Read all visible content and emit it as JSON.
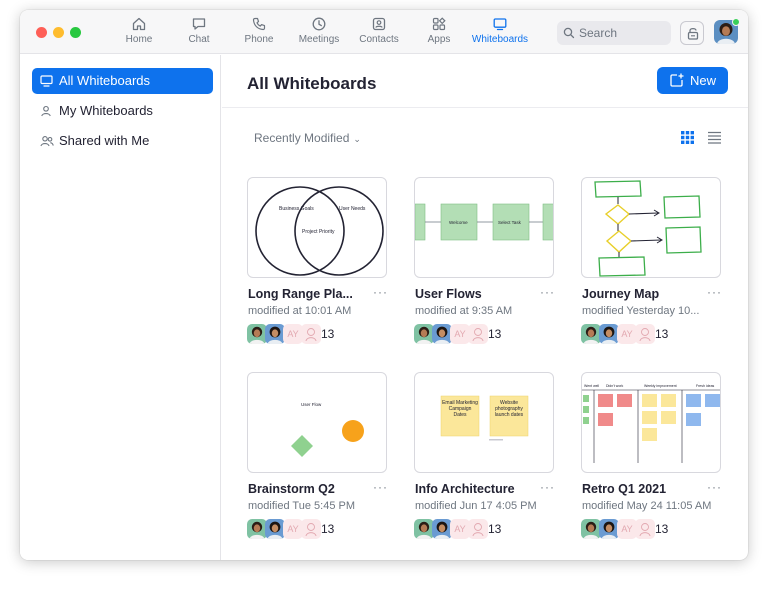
{
  "nav": {
    "tabs": [
      {
        "label": "Home",
        "icon": "home-icon"
      },
      {
        "label": "Chat",
        "icon": "chat-icon"
      },
      {
        "label": "Phone",
        "icon": "phone-icon"
      },
      {
        "label": "Meetings",
        "icon": "clock-icon"
      },
      {
        "label": "Contacts",
        "icon": "contacts-icon"
      },
      {
        "label": "Apps",
        "icon": "apps-icon"
      },
      {
        "label": "Whiteboards",
        "icon": "whiteboard-icon"
      }
    ],
    "active_tab": "Whiteboards",
    "search_placeholder": "Search"
  },
  "sidebar": {
    "items": [
      {
        "label": "All Whiteboards",
        "icon": "whiteboard-icon",
        "active": true
      },
      {
        "label": "My Whiteboards",
        "icon": "person-icon",
        "active": false
      },
      {
        "label": "Shared with Me",
        "icon": "people-icon",
        "active": false
      }
    ]
  },
  "main": {
    "title": "All Whiteboards",
    "new_label": "New",
    "sort_label": "Recently Modified"
  },
  "cards": [
    {
      "title": "Long Range Pla...",
      "modified": "modified at 10:01 AM",
      "count": "13",
      "thumb_text": {
        "a": "Business Goals",
        "b": "User Needs",
        "c": "Project Priority"
      }
    },
    {
      "title": "User Flows",
      "modified": "modified at 9:35 AM",
      "count": "13",
      "thumb_text": {
        "a": "Welcome",
        "b": "Select Task"
      }
    },
    {
      "title": "Journey Map",
      "modified": "modified Yesterday 10...",
      "count": "13"
    },
    {
      "title": "Brainstorm Q2",
      "modified": "modified Tue 5:45 PM",
      "count": "13",
      "thumb_text": {
        "a": "User Flow"
      }
    },
    {
      "title": "Info Architecture",
      "modified": "modified Jun 17 4:05 PM",
      "count": "13",
      "thumb_text": {
        "a": "Email Marketing Campaign Dates",
        "b": "Website photography launch dates"
      }
    },
    {
      "title": "Retro Q1 2021",
      "modified": "modified May 24 11:05 AM",
      "count": "13",
      "thumb_text": {
        "a": "Went well",
        "b": "Didn't work",
        "c": "Weekly improvement",
        "d": "Fresh ideas"
      }
    }
  ],
  "collaborator_initials": "AY",
  "colors": {
    "accent": "#0e72ed",
    "sticky_yellow": "#fbe79a",
    "shape_green": "#8fd18f",
    "shape_orange": "#f7a21b"
  }
}
